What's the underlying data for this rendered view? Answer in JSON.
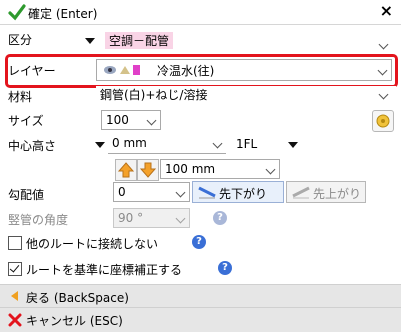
{
  "header": {
    "title": "確定 (Enter)",
    "close": "×"
  },
  "fields": {
    "kubun": {
      "label": "区分",
      "value": "空調－配管"
    },
    "layer": {
      "label": "レイヤー",
      "value": "冷温水(往)"
    },
    "material": {
      "label": "材料",
      "value": "鋼管(白)+ねじ/溶接"
    },
    "size": {
      "label": "サイズ",
      "value": "100"
    },
    "center_height": {
      "label": "中心高さ",
      "value": "0 mm",
      "ref": "1FL"
    },
    "offset": {
      "value": "100 mm"
    },
    "slope": {
      "label": "勾配値",
      "value": "0",
      "down_label": "先下がり",
      "up_label": "先上がり"
    },
    "vertical_angle": {
      "label": "竪管の角度",
      "value": "90 °"
    }
  },
  "options": {
    "no_connect_label": "他のルートに接続しない",
    "coord_correct_label": "ルートを基準に座標補正する"
  },
  "footer": {
    "back_label": "戻る (BackSpace)",
    "cancel_label": "キャンセル (ESC)"
  },
  "colors": {
    "highlight": "#e3141d",
    "accent": "#3a6fd6",
    "layer_swatch": "#e040c8"
  }
}
